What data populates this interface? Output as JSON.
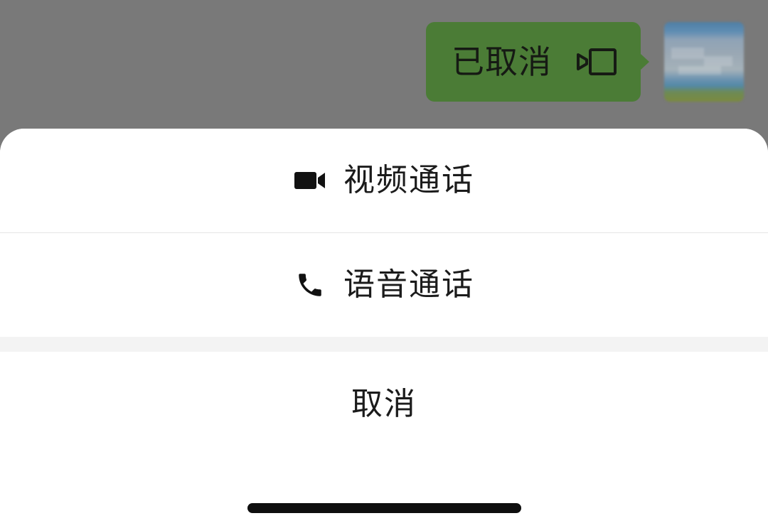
{
  "chat": {
    "bubble_text": "已取消",
    "bubble_icon": "video-call-icon",
    "bubble_color": "#4b7c36"
  },
  "action_sheet": {
    "items": [
      {
        "label": "视频通话",
        "icon": "video-camera-icon"
      },
      {
        "label": "语音通话",
        "icon": "phone-icon"
      }
    ],
    "cancel_label": "取消"
  }
}
